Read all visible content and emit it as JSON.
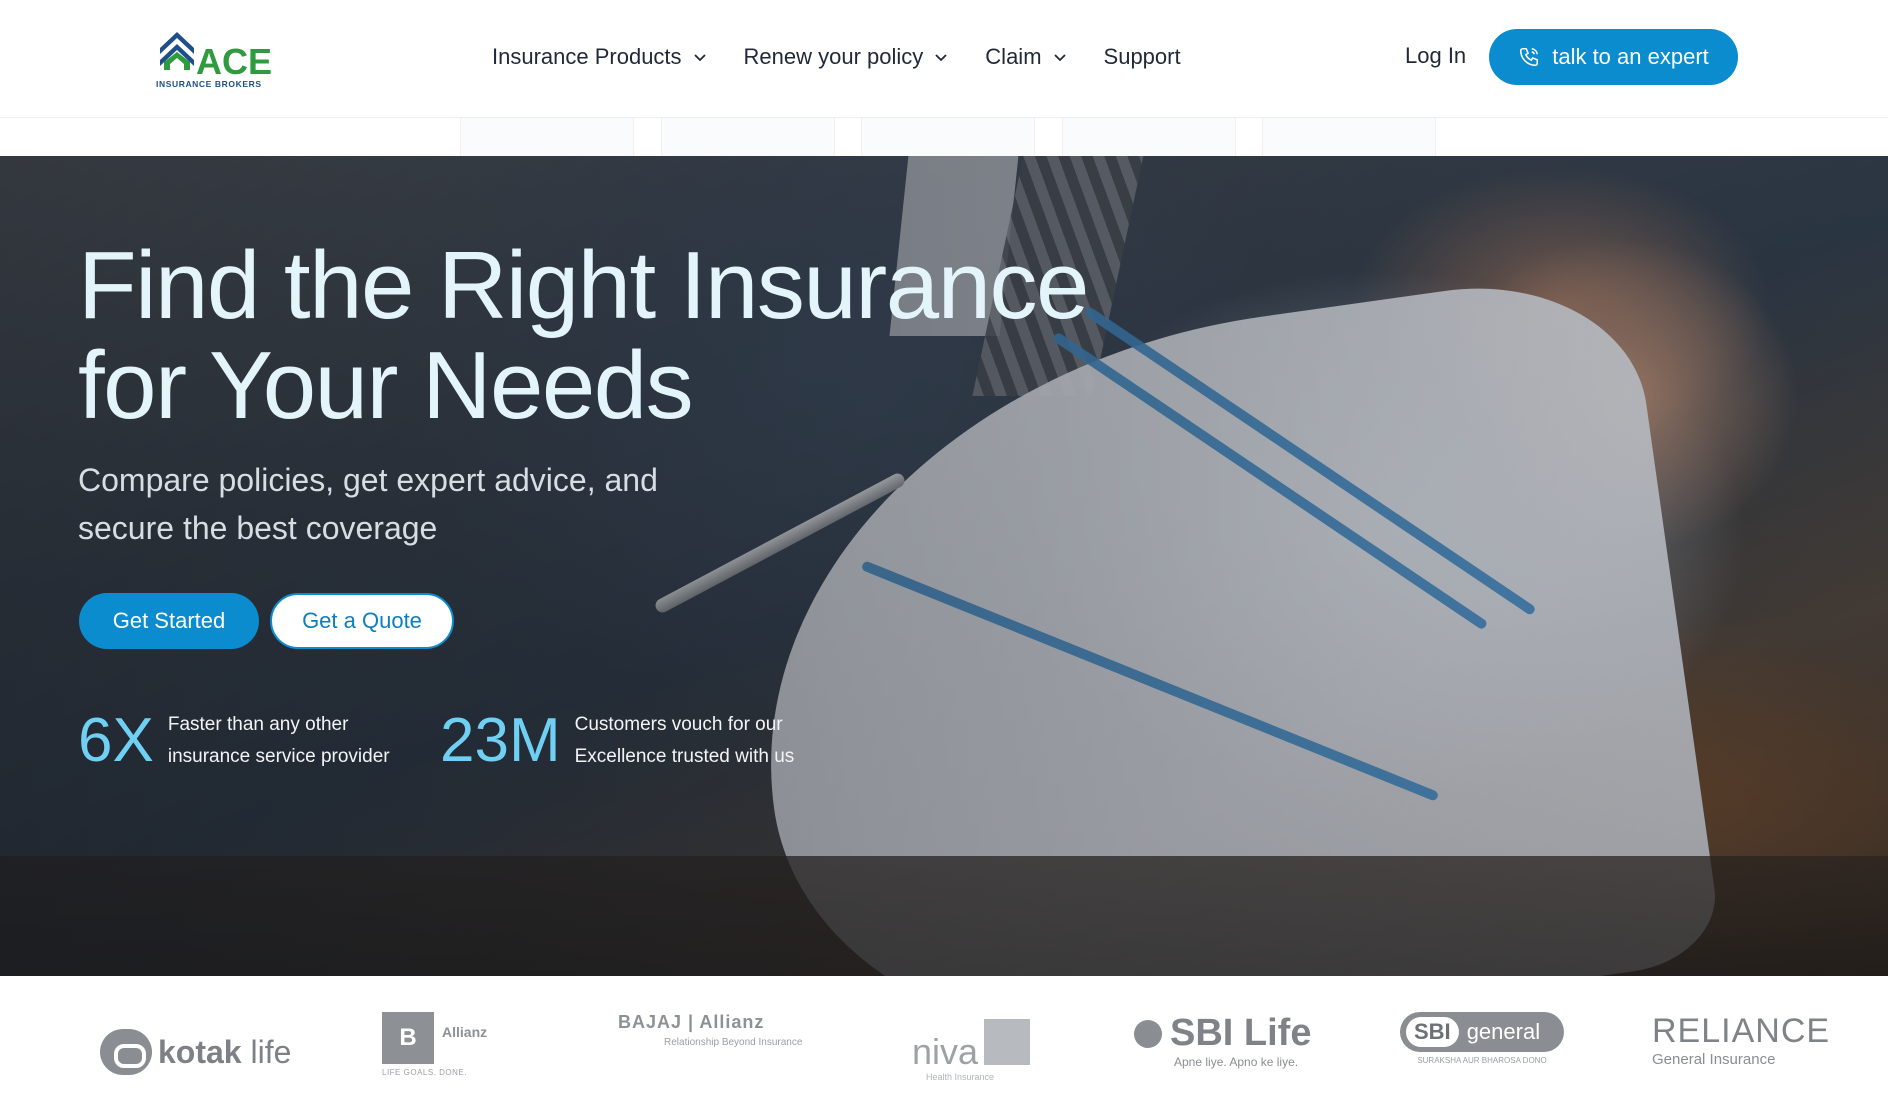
{
  "header": {
    "logo": {
      "word": "ACE",
      "subtitle": "INSURANCE BROKERS"
    },
    "nav": [
      {
        "label": "Insurance Products",
        "has_dropdown": true
      },
      {
        "label": "Renew your policy",
        "has_dropdown": true
      },
      {
        "label": "Claim",
        "has_dropdown": true
      },
      {
        "label": "Support",
        "has_dropdown": false
      }
    ],
    "login_label": "Log In",
    "cta_label": "talk to an expert"
  },
  "hero": {
    "title_line1": "Find the Right Insurance",
    "title_line2": "for Your Needs",
    "subtitle_line1": "Compare policies, get expert advice, and",
    "subtitle_line2": "secure the best coverage",
    "primary_button": "Get Started",
    "secondary_button": "Get a Quote",
    "stats": [
      {
        "value": "6X",
        "line1": "Faster than any other",
        "line2": "insurance service provider"
      },
      {
        "value": "23M",
        "line1": "Customers vouch for our",
        "line2": "Excellence trusted with us"
      }
    ]
  },
  "partners": {
    "kotak": {
      "bold": "kotak",
      "rest": " life"
    },
    "bajaj_allianz_life": {
      "box": "B",
      "name": "Allianz",
      "tag": "LIFE GOALS. DONE."
    },
    "bajaj_allianz_general": {
      "line1": "BAJAJ | Allianz",
      "line2": "Relationship Beyond Insurance"
    },
    "niva": {
      "name": "niva",
      "tag": "Health Insurance"
    },
    "sbi_life": {
      "name": "SBI Life",
      "tag": "Apne liye. Apno ke liye."
    },
    "sbi_general": {
      "badge": "SBI",
      "name": "general",
      "tag": "SURAKSHA AUR BHAROSA DONO"
    },
    "reliance": {
      "name": "RELIANCE",
      "tag": "General Insurance"
    }
  },
  "colors": {
    "accent": "#0b8ccf",
    "logo_green": "#2f9a3e",
    "logo_blue": "#1e4f8a",
    "stat_number": "#6fd0f3",
    "hero_title": "#e4f4fb"
  }
}
